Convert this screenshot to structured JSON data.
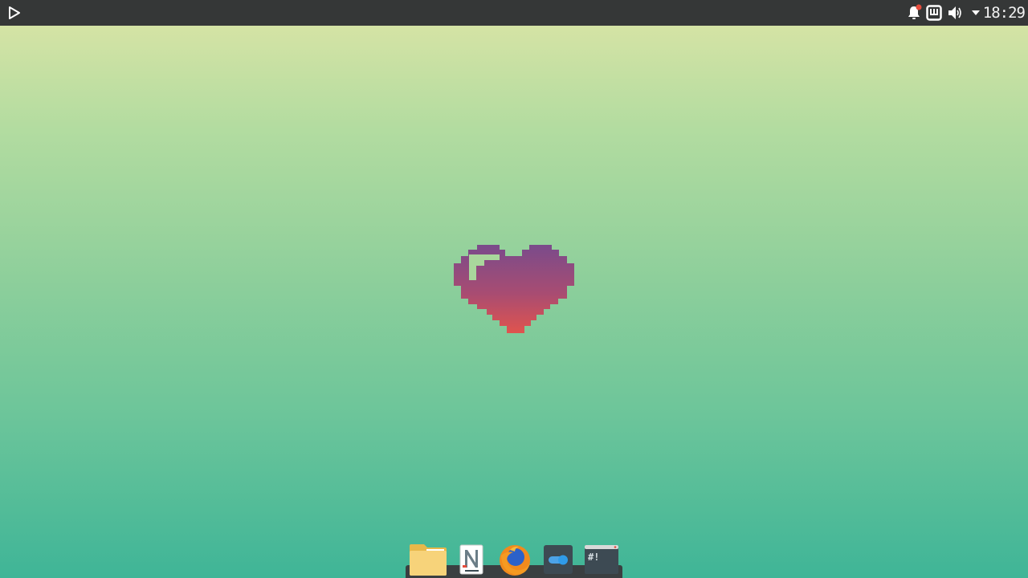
{
  "panel": {
    "clock": "18:29",
    "tray": [
      "notifications-icon",
      "network-icon",
      "volume-icon",
      "menu-arrow-icon"
    ],
    "notification_dot_color": "#e74c3c"
  },
  "launcher": {
    "icon": "app-launcher-icon"
  },
  "wallpaper": {
    "gradient_top": "#dde5a6",
    "gradient_bottom": "#3fb597",
    "heart_top_color": "#7a4b8b",
    "heart_bottom_color": "#e0544e"
  },
  "dock": {
    "items": [
      "file-manager-icon",
      "text-editor-icon",
      "firefox-icon",
      "settings-toggle-icon",
      "terminal-icon"
    ],
    "terminal_glyph": "#!"
  }
}
